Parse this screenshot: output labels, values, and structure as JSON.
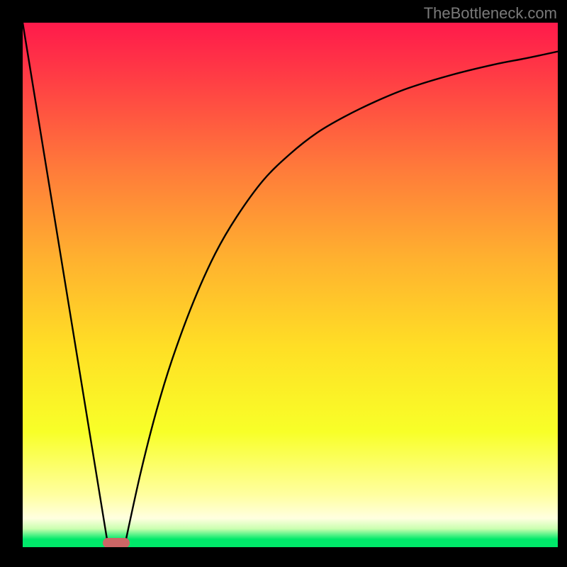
{
  "watermark": "TheBottleneck.com",
  "chart_data": {
    "type": "line",
    "title": "",
    "xlabel": "",
    "ylabel": "",
    "xlim": [
      0,
      100
    ],
    "ylim": [
      0,
      100
    ],
    "gradient_stops": [
      {
        "offset": 0.0,
        "color": "#ff1a4b"
      },
      {
        "offset": 0.1,
        "color": "#ff3b45"
      },
      {
        "offset": 0.28,
        "color": "#ff7b3a"
      },
      {
        "offset": 0.45,
        "color": "#ffb12f"
      },
      {
        "offset": 0.62,
        "color": "#ffdf25"
      },
      {
        "offset": 0.78,
        "color": "#f8ff28"
      },
      {
        "offset": 0.9,
        "color": "#ffffa0"
      },
      {
        "offset": 0.945,
        "color": "#ffffe0"
      },
      {
        "offset": 0.965,
        "color": "#caffb0"
      },
      {
        "offset": 0.985,
        "color": "#00e96a"
      },
      {
        "offset": 1.0,
        "color": "#00e96a"
      }
    ],
    "series": [
      {
        "name": "left-line",
        "x": [
          0,
          16
        ],
        "y": [
          100,
          0
        ]
      },
      {
        "name": "right-curve",
        "x": [
          19,
          22,
          25,
          28,
          32,
          36,
          40,
          45,
          50,
          55,
          60,
          66,
          72,
          80,
          88,
          94,
          100
        ],
        "y": [
          0,
          14,
          26,
          36,
          47,
          56,
          63,
          70,
          75,
          79,
          82,
          85,
          87.5,
          90,
          92,
          93.2,
          94.5
        ]
      }
    ],
    "marker": {
      "x_start": 15,
      "x_end": 20,
      "y": 0.8,
      "color": "#cc6666"
    }
  }
}
